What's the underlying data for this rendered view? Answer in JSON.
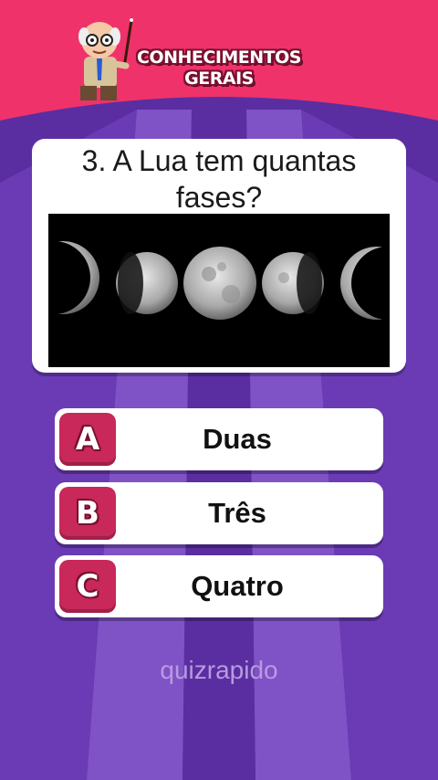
{
  "header": {
    "brand_line1": "CONHECIMENTOS",
    "brand_line2": "GERAIS",
    "mascot_icon": "professor-mascot-icon",
    "band_color": "#f0326a"
  },
  "question": {
    "text": "3. A Lua tem quantas fases?",
    "image_description_icon": "moon-phases-icon"
  },
  "answers": [
    {
      "letter": "A",
      "label": "Duas"
    },
    {
      "letter": "B",
      "label": "Três"
    },
    {
      "letter": "C",
      "label": "Quatro"
    }
  ],
  "footer": {
    "watermark": "quizrapido"
  },
  "colors": {
    "background": "#5a2ea0",
    "ray_light": "#8a5ccf",
    "badge": "#c8285a"
  }
}
